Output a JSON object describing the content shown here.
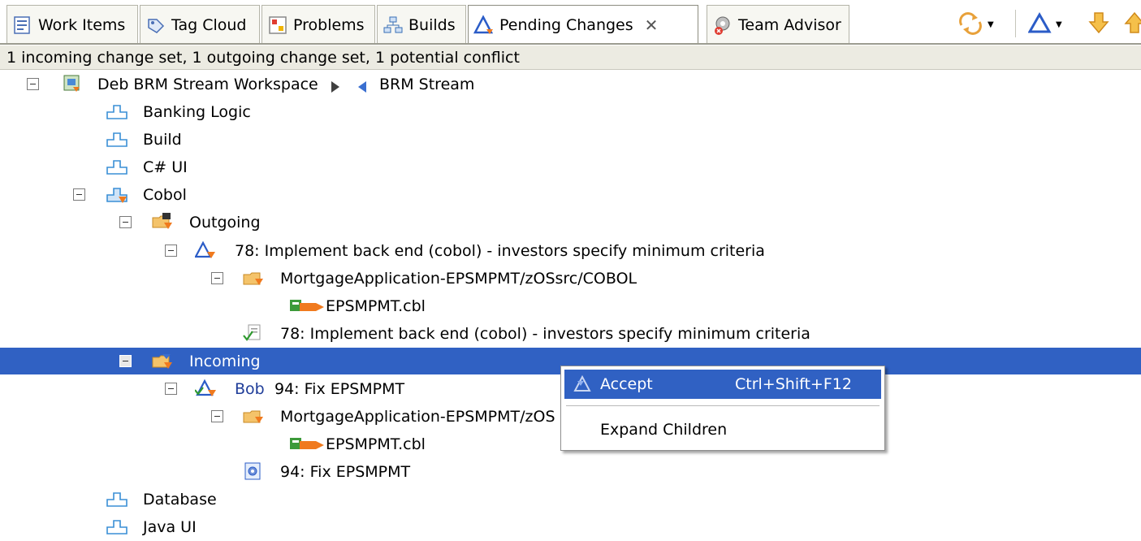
{
  "tabs": [
    {
      "label": "Work Items",
      "icon": "work-items-icon"
    },
    {
      "label": "Tag Cloud",
      "icon": "tag-cloud-icon"
    },
    {
      "label": "Problems",
      "icon": "problems-icon"
    },
    {
      "label": "Builds",
      "icon": "builds-icon"
    },
    {
      "label": "Pending Changes",
      "icon": "pending-changes-icon",
      "active": true
    },
    {
      "label": "Team Advisor",
      "icon": "team-advisor-icon"
    }
  ],
  "toolbar": {
    "sync_icon": "refresh-icon",
    "delta_icon": "delta-icon",
    "down_icon": "arrow-down-icon",
    "up_icon": "arrow-up-icon",
    "close_glyph": "✕"
  },
  "status": "1 incoming change set, 1 outgoing change set, 1 potential conflict",
  "tree": {
    "workspace": "Deb BRM Stream Workspace",
    "stream": "BRM Stream",
    "components": {
      "banking_logic": "Banking Logic",
      "build": "Build",
      "csharp_ui": "C# UI",
      "cobol": "Cobol",
      "database": "Database",
      "java_ui": "Java UI"
    },
    "outgoing": {
      "label": "Outgoing",
      "change_set": "78: Implement back end (cobol) - investors specify minimum criteria",
      "folder": "MortgageApplication-EPSMPMT/zOSsrc/COBOL",
      "file": "EPSMPMT.cbl",
      "work_item": "78: Implement back end (cobol) - investors specify minimum criteria"
    },
    "incoming": {
      "label": "Incoming",
      "author": "Bob",
      "change_set": "94: Fix EPSMPMT",
      "folder": "MortgageApplication-EPSMPMT/zOS",
      "file": "EPSMPMT.cbl",
      "work_item": "94: Fix EPSMPMT"
    }
  },
  "context_menu": {
    "accept": {
      "label": "Accept",
      "shortcut": "Ctrl+Shift+F12"
    },
    "expand": {
      "label": "Expand Children"
    }
  },
  "colors": {
    "selection": "#3061c3",
    "folder": "#e8a13a",
    "component": "#3a8fd6",
    "incoming_arrow": "#3a6fd0",
    "change_orange": "#f07a1e"
  }
}
